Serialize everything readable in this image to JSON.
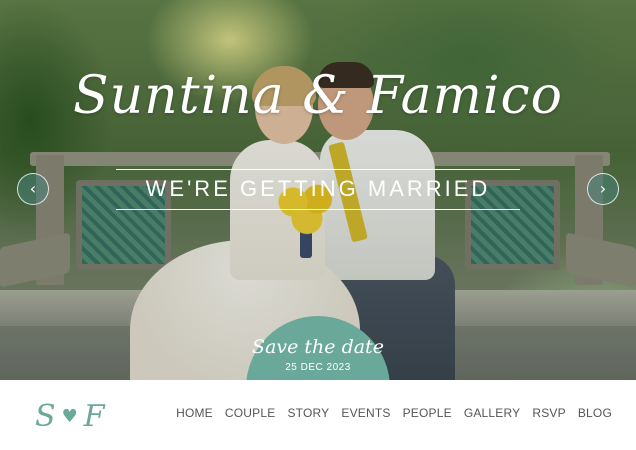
{
  "hero": {
    "title": "Suntina & Famico",
    "tagline": "WE'RE GETTING MARRIED",
    "prev_arrow": "‹",
    "next_arrow": "›"
  },
  "save_the_date": {
    "label": "Save the date",
    "date": "25 DEC 2023"
  },
  "logo": {
    "left_initial": "S",
    "heart": "♥",
    "right_initial": "F"
  },
  "nav": {
    "items": [
      "HOME",
      "COUPLE",
      "STORY",
      "EVENTS",
      "PEOPLE",
      "GALLERY",
      "RSVP",
      "BLOG"
    ]
  },
  "colors": {
    "accent": "#6aa89a",
    "nav_text": "#555555"
  }
}
